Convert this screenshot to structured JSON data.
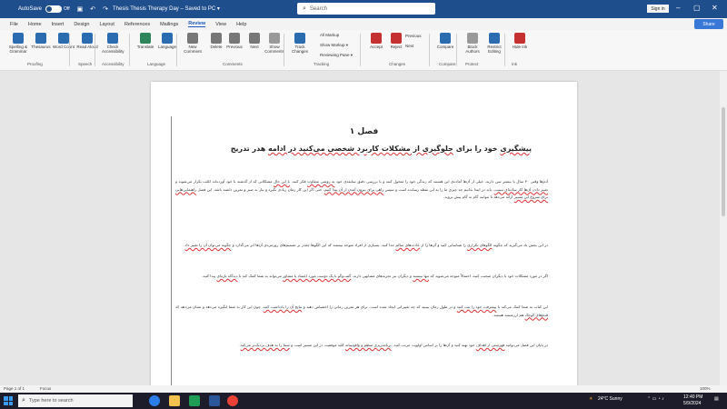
{
  "titlebar": {
    "autosave_label": "AutoSave",
    "autosave_state": "Off",
    "doc_title": "Thesis Thesis Therapy Day – Saved to PC ▾",
    "search_placeholder": "Search",
    "signin_label": "Sign in"
  },
  "tabs": [
    "File",
    "Home",
    "Insert",
    "Design",
    "Layout",
    "References",
    "Mailings",
    "Review",
    "View",
    "Help"
  ],
  "active_tab": "Review",
  "share_label": "Share",
  "ribbon": {
    "buttons": [
      {
        "name": "spelling-grammar",
        "label": "Spelling & Grammar",
        "color": "#2b6cb0"
      },
      {
        "name": "thesaurus",
        "label": "Thesaurus",
        "color": "#2b6cb0"
      },
      {
        "name": "word-count",
        "label": "Word Count",
        "color": "#2b6cb0"
      },
      {
        "name": "read-aloud",
        "label": "Read Aloud",
        "color": "#2b6cb0"
      },
      {
        "name": "check-accessibility",
        "label": "Check Accessibility",
        "color": "#2b6cb0"
      },
      {
        "name": "translate",
        "label": "Translate",
        "color": "#2f855a"
      },
      {
        "name": "language",
        "label": "Language",
        "color": "#2b6cb0"
      },
      {
        "name": "new-comment",
        "label": "New Comment",
        "color": "#777"
      },
      {
        "name": "delete",
        "label": "Delete",
        "color": "#777"
      },
      {
        "name": "previous",
        "label": "Previous",
        "color": "#777"
      },
      {
        "name": "next",
        "label": "Next",
        "color": "#777"
      },
      {
        "name": "show-comments",
        "label": "Show Comments",
        "color": "#999"
      },
      {
        "name": "track-changes",
        "label": "Track Changes",
        "color": "#2b6cb0"
      },
      {
        "name": "accept",
        "label": "Accept",
        "color": "#c53030"
      },
      {
        "name": "reject",
        "label": "Reject",
        "color": "#c53030"
      },
      {
        "name": "compare",
        "label": "Compare",
        "color": "#2b6cb0"
      },
      {
        "name": "block-authors",
        "label": "Block Authors",
        "color": "#999"
      },
      {
        "name": "restrict-editing",
        "label": "Restrict Editing",
        "color": "#2b6cb0"
      },
      {
        "name": "hide-ink",
        "label": "Hide Ink",
        "color": "#c53030"
      }
    ],
    "groups": [
      "Proofing",
      "Speech",
      "Accessibility",
      "Language",
      "Comments",
      "Tracking",
      "Changes",
      "Compare",
      "Protect",
      "Ink"
    ],
    "tracking_options": [
      "All Markup",
      "Show Markup ▾",
      "Reviewing Pane ▾"
    ],
    "changes_options": [
      "Previous",
      "Next"
    ]
  },
  "document": {
    "chapter": "فصل ۱",
    "heading_parts": [
      {
        "text": "پیشگیری",
        "u": true
      },
      {
        "text": " خود را برای ",
        "u": false
      },
      {
        "text": "جلوگیری از مشکلات کاربرد شخصی می‌کنید در ادامه",
        "u": true
      },
      {
        "text": " هدر تدریج",
        "u": false
      }
    ],
    "paragraphs": [
      [
        {
          "text": "آدم‌ها وقتی ۳۰ سال یا بیشتر سن دارند، خیلی از آن‌ها آماده‌ی این هستند که زندگی خود را متحول کنند و با بررسی دقیق سابقه‌ی خود ",
          "u": false
        },
        {
          "text": "به روشی متفاوت",
          "u": true
        },
        {
          "text": " فکر کنند. ",
          "u": false
        },
        {
          "text": "با این حال",
          "u": true
        },
        {
          "text": " مشکلاتی که از گذشته با خود آورده‌اند اغلب تکرار می‌شوند و ",
          "u": false
        },
        {
          "text": "تغییر دادن آن‌ها کار ساده‌ای نیست",
          "u": true
        },
        {
          "text": ". باید در ابتدا بدانیم چه چیزی ما را به این نقطه رسانده است و سپس ",
          "u": false
        },
        {
          "text": "راهی برای بیرون آمدن از آن پیدا کنیم",
          "u": true
        },
        {
          "text": "، حتی اگر این کار زمان زیادی بگیرد و نیاز به صبر و تمرین داشته باشد. این فصل ",
          "u": false
        },
        {
          "text": "راهنمایی‌هایی برای شروع این مسیر",
          "u": true
        },
        {
          "text": " ارائه می‌دهد تا بتوانید گام به گام پیش بروید.",
          "u": false
        }
      ],
      [
        {
          "text": "در این بخش یاد می‌گیرید که چگونه ",
          "u": false
        },
        {
          "text": "الگوهای تکراری",
          "u": true
        },
        {
          "text": " را شناسایی کنید و آن‌ها را از ",
          "u": false
        },
        {
          "text": "عادت‌های سالم",
          "u": true
        },
        {
          "text": " جدا کنید. بسیاری از افراد متوجه نیستند که این الگوها چقدر بر تصمیم‌های روزمره‌ی آن‌ها اثر می‌گذارد و ",
          "u": false
        },
        {
          "text": "چگونه می‌توان آن را تغییر داد",
          "u": true
        },
        {
          "text": ".",
          "u": false
        }
      ],
      [
        {
          "text": "اگر در مورد مشکلات خود با دیگران صحبت کنید، احتمالاً متوجه می‌شوید که ",
          "u": false
        },
        {
          "text": "تنها نیستید",
          "u": true
        },
        {
          "text": " و دیگران نیز تجربه‌های مشابهی دارند. ",
          "u": false
        },
        {
          "text": "گفت‌وگو با یک دوست مورد اعتماد یا مشاور",
          "u": true
        },
        {
          "text": " می‌تواند به شما کمک کند تا ",
          "u": false
        },
        {
          "text": "دیدگاه تازه‌ای",
          "u": true
        },
        {
          "text": " پیدا کنید.",
          "u": false
        }
      ],
      [
        {
          "text": "این کتاب به شما کمک می‌کند تا ",
          "u": false
        },
        {
          "text": "پیشرفت خود را ثبت کنید",
          "u": true
        },
        {
          "text": " و در طول زمان ببینید که چه تغییراتی ایجاد شده است. برای هر تمرین زمانی را اختصاص دهید و ",
          "u": false
        },
        {
          "text": "نتایج آن را یادداشت کنید",
          "u": true
        },
        {
          "text": "، چون این کار به شما انگیزه می‌دهد و نشان می‌دهد که ",
          "u": false
        },
        {
          "text": "قدم‌های کوچک",
          "u": true
        },
        {
          "text": " هم ارزشمند هستند.",
          "u": false
        }
      ],
      [
        {
          "text": "در پایان این فصل می‌توانید ",
          "u": false
        },
        {
          "text": "فهرستی از اهداف",
          "u": true
        },
        {
          "text": " خود تهیه کنید و آن‌ها را بر اساس اولویت مرتب کنید. ",
          "u": false
        },
        {
          "text": "برنامه‌ریزی منظم و واقع‌بینانه",
          "u": true
        },
        {
          "text": " کلید موفقیت در این مسیر است و ",
          "u": false
        },
        {
          "text": "شما را به هدف نزدیک‌تر می‌کند",
          "u": true
        },
        {
          "text": ".",
          "u": false
        }
      ]
    ]
  },
  "status": {
    "page": "Page 1 of 1",
    "focus": "Focus",
    "zoom": "100%"
  },
  "taskbar": {
    "search_placeholder": "Type here to search",
    "weather": "24°C Sunny",
    "time": "12:40 PM",
    "date": "5/9/2024"
  }
}
